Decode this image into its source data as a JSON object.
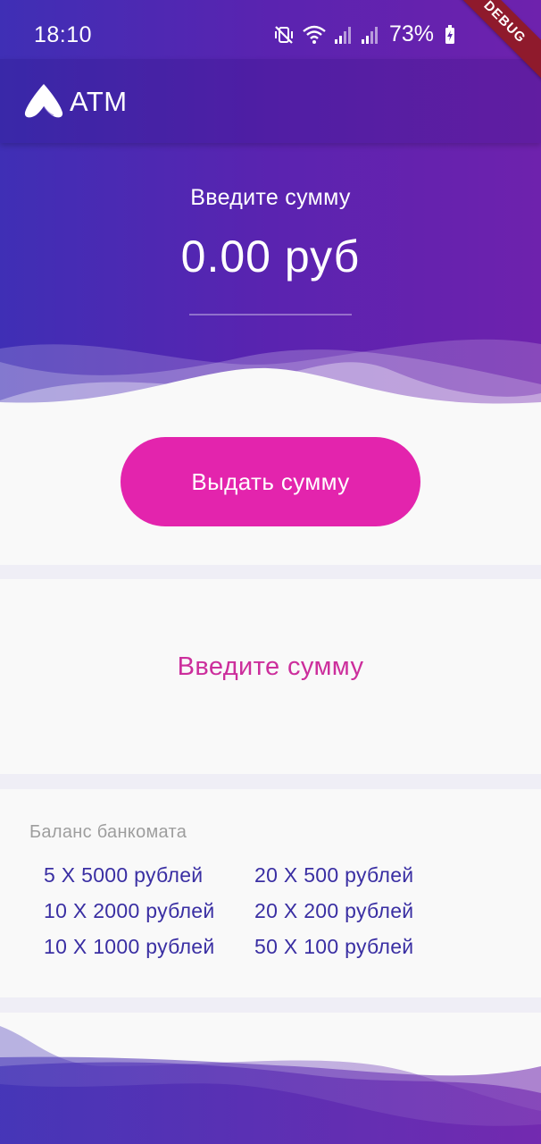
{
  "status_bar": {
    "time": "18:10",
    "battery_percent": "73%",
    "icons": [
      "mute-vibrate-icon",
      "wifi-icon",
      "signal-icon",
      "signal-icon",
      "battery-charging-icon"
    ]
  },
  "debug_banner": "DEBUG",
  "app_bar": {
    "title": "ATM",
    "logo_icon": "atm-logo-icon"
  },
  "hero": {
    "label": "Введите сумму",
    "amount": "0.00 руб"
  },
  "actions": {
    "withdraw_label": "Выдать сумму"
  },
  "message": {
    "text": "Введите сумму"
  },
  "balance": {
    "title": "Баланс банкомата",
    "items": [
      "5 X 5000 рублей",
      "20 X 500 рублей",
      "10 X 2000 рублей",
      "20 X 200 рублей",
      "10 X 1000 рублей",
      "50 X 100 рублей"
    ]
  },
  "colors": {
    "gradient_start": "#3f2fb5",
    "gradient_end": "#6e22ad",
    "accent_pink": "#e324ad",
    "message_pink": "#cc2e9c",
    "balance_text": "#3a2fa3",
    "card_bg": "#f9f9f9",
    "page_bg": "#efeef6"
  }
}
